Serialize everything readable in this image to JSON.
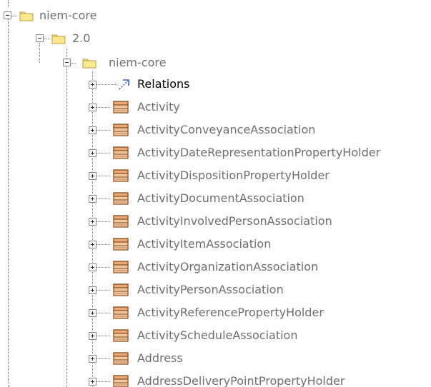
{
  "tree": {
    "root_folder": {
      "label": "niem-core",
      "state": "expanded",
      "icon": "folder-icon"
    },
    "version_folder": {
      "label": "2.0",
      "state": "expanded",
      "icon": "folder-icon"
    },
    "package_folder": {
      "label": "niem-core",
      "state": "expanded",
      "icon": "folder-icon"
    },
    "items": [
      {
        "label": "Relations",
        "icon": "relations-icon",
        "state": "collapsed"
      },
      {
        "label": "Activity",
        "icon": "class-icon",
        "state": "collapsed"
      },
      {
        "label": "ActivityConveyanceAssociation",
        "icon": "class-icon",
        "state": "collapsed"
      },
      {
        "label": "ActivityDateRepresentationPropertyHolder",
        "icon": "class-icon",
        "state": "collapsed"
      },
      {
        "label": "ActivityDispositionPropertyHolder",
        "icon": "class-icon",
        "state": "collapsed"
      },
      {
        "label": "ActivityDocumentAssociation",
        "icon": "class-icon",
        "state": "collapsed"
      },
      {
        "label": "ActivityInvolvedPersonAssociation",
        "icon": "class-icon",
        "state": "collapsed"
      },
      {
        "label": "ActivityItemAssociation",
        "icon": "class-icon",
        "state": "collapsed"
      },
      {
        "label": "ActivityOrganizationAssociation",
        "icon": "class-icon",
        "state": "collapsed"
      },
      {
        "label": "ActivityPersonAssociation",
        "icon": "class-icon",
        "state": "collapsed"
      },
      {
        "label": "ActivityReferencePropertyHolder",
        "icon": "class-icon",
        "state": "collapsed"
      },
      {
        "label": "ActivityScheduleAssociation",
        "icon": "class-icon",
        "state": "collapsed"
      },
      {
        "label": "Address",
        "icon": "class-icon",
        "state": "collapsed"
      },
      {
        "label": "AddressDeliveryPointPropertyHolder",
        "icon": "class-icon",
        "state": "collapsed"
      }
    ]
  },
  "colors": {
    "label_text": "#6f6f6f",
    "label_text_strong": "#000000",
    "folder_fill": "#f7e58a",
    "folder_border": "#b8a040",
    "class_fill": "#f0c8a0",
    "class_border": "#8a4a20",
    "relations_arrow": "#3b5bdb",
    "tree_lines": "#7a7a7a"
  }
}
